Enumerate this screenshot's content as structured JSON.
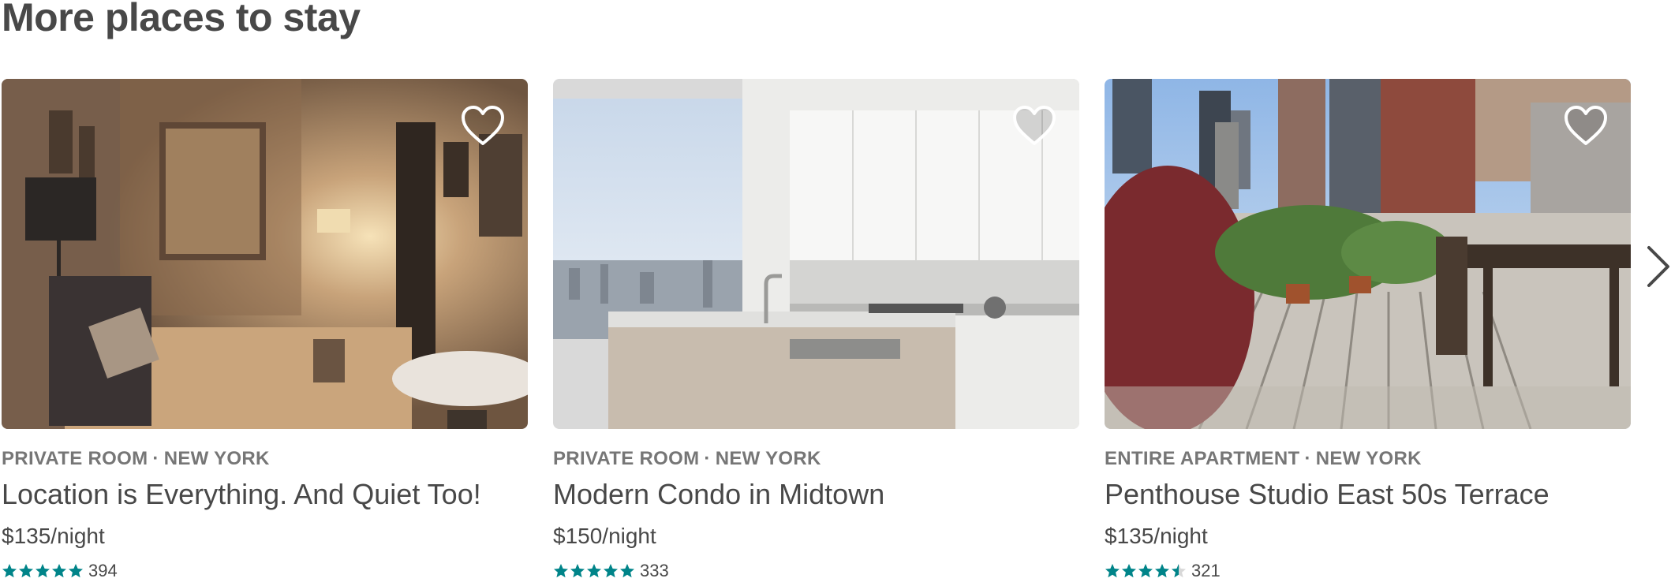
{
  "section": {
    "title": "More places to stay"
  },
  "colors": {
    "text": "#484848",
    "muted": "#767676",
    "star": "#008489"
  },
  "listings": [
    {
      "type": "PRIVATE ROOM",
      "separator": "·",
      "city": "NEW YORK",
      "title": "Location is Everything. And Quiet Too!",
      "price": "$135/night",
      "rating": 5,
      "reviews": "394",
      "icon": "heart-icon"
    },
    {
      "type": "PRIVATE ROOM",
      "separator": "·",
      "city": "NEW YORK",
      "title": "Modern Condo in Midtown",
      "price": "$150/night",
      "rating": 5,
      "reviews": "333",
      "icon": "heart-icon"
    },
    {
      "type": "ENTIRE APARTMENT",
      "separator": "·",
      "city": "NEW YORK",
      "title": "Penthouse Studio East 50s Terrace",
      "price": "$135/night",
      "rating": 4.5,
      "reviews": "321",
      "icon": "heart-icon"
    }
  ],
  "navigation": {
    "next_icon": "chevron-right-icon"
  }
}
